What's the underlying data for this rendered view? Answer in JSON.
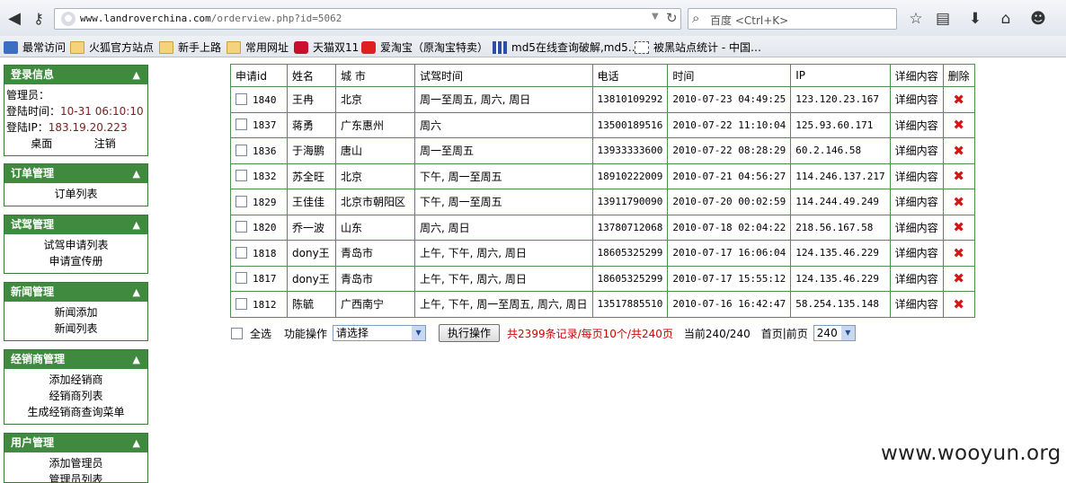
{
  "browser": {
    "url_host": "www.landroverchina.com",
    "url_path": "/orderview.php?id=5062",
    "search_placeholder": "百度 <Ctrl+K>"
  },
  "bookmarks": [
    {
      "label": "最常访问"
    },
    {
      "label": "火狐官方站点"
    },
    {
      "label": "新手上路"
    },
    {
      "label": "常用网址"
    },
    {
      "label": "天猫双11"
    },
    {
      "label": "爱淘宝（原淘宝特卖）"
    },
    {
      "label": "md5在线查询破解,md5…"
    },
    {
      "label": "被黑站点统计 - 中国…"
    }
  ],
  "sidebar": {
    "login": {
      "title": "登录信息",
      "admin_label": "管理员：",
      "time_label": "登陆时间：",
      "time_value": "10-31 06:10:10",
      "ip_label": "登陆IP：",
      "ip_value": "183.19.20.223",
      "desktop": "桌面",
      "logout": "注销"
    },
    "orders": {
      "title": "订单管理",
      "items": [
        "订单列表"
      ]
    },
    "testdrive": {
      "title": "试驾管理",
      "items": [
        "试驾申请列表",
        "申请宣传册"
      ]
    },
    "news": {
      "title": "新闻管理",
      "items": [
        "新闻添加",
        "新闻列表"
      ]
    },
    "dealers": {
      "title": "经销商管理",
      "items": [
        "添加经销商",
        "经销商列表",
        "生成经销商查询菜单"
      ]
    },
    "users": {
      "title": "用户管理",
      "items": [
        "添加管理员",
        "管理员列表"
      ]
    }
  },
  "table": {
    "headers": [
      "申请id",
      "姓名",
      "城 市",
      "试驾时间",
      "电话",
      "时间",
      "IP",
      "详细内容",
      "删除"
    ],
    "detail_label": "详细内容",
    "rows": [
      {
        "id": "1840",
        "name": "王冉",
        "city": "北京",
        "drive_time": "周一至周五, 周六, 周日",
        "phone": "13810109292",
        "time": "2010-07-23 04:49:25",
        "ip": "123.120.23.167"
      },
      {
        "id": "1837",
        "name": "蒋勇",
        "city": "广东惠州",
        "drive_time": "周六",
        "phone": "13500189516",
        "time": "2010-07-22 11:10:04",
        "ip": "125.93.60.171"
      },
      {
        "id": "1836",
        "name": "于海鹏",
        "city": "唐山",
        "drive_time": "周一至周五",
        "phone": "13933333600",
        "time": "2010-07-22 08:28:29",
        "ip": "60.2.146.58"
      },
      {
        "id": "1832",
        "name": "苏全旺",
        "city": "北京",
        "drive_time": "下午, 周一至周五",
        "phone": "18910222009",
        "time": "2010-07-21 04:56:27",
        "ip": "114.246.137.217"
      },
      {
        "id": "1829",
        "name": "王佳佳",
        "city": "北京市朝阳区",
        "drive_time": "下午, 周一至周五",
        "phone": "13911790090",
        "time": "2010-07-20 00:02:59",
        "ip": "114.244.49.249"
      },
      {
        "id": "1820",
        "name": "乔一波",
        "city": "山东",
        "drive_time": "周六, 周日",
        "phone": "13780712068",
        "time": "2010-07-18 02:04:22",
        "ip": "218.56.167.58"
      },
      {
        "id": "1818",
        "name": "dony王",
        "city": "青岛市",
        "drive_time": "上午, 下午, 周六, 周日",
        "phone": "18605325299",
        "time": "2010-07-17 16:06:04",
        "ip": "124.135.46.229"
      },
      {
        "id": "1817",
        "name": "dony王",
        "city": "青岛市",
        "drive_time": "上午, 下午, 周六, 周日",
        "phone": "18605325299",
        "time": "2010-07-17 15:55:12",
        "ip": "124.135.46.229"
      },
      {
        "id": "1812",
        "name": "陈毓",
        "city": "广西南宁",
        "drive_time": "上午, 下午, 周一至周五, 周六, 周日",
        "phone": "13517885510",
        "time": "2010-07-16 16:42:47",
        "ip": "58.254.135.148"
      }
    ]
  },
  "toolbar": {
    "select_all": "全选",
    "function_label": "功能操作",
    "function_selected": "请选择",
    "execute": "执行操作",
    "summary": "共2399条记录/每页10个/共240页",
    "current": "当前240/240",
    "first": "首页",
    "sep": "|",
    "prev": "前页",
    "page_selected": "240"
  },
  "watermark": "www.wooyun.org",
  "colors": {
    "header_green": "#3f8a3f",
    "delete_red": "#d01818",
    "summary_red": "#d00000"
  }
}
